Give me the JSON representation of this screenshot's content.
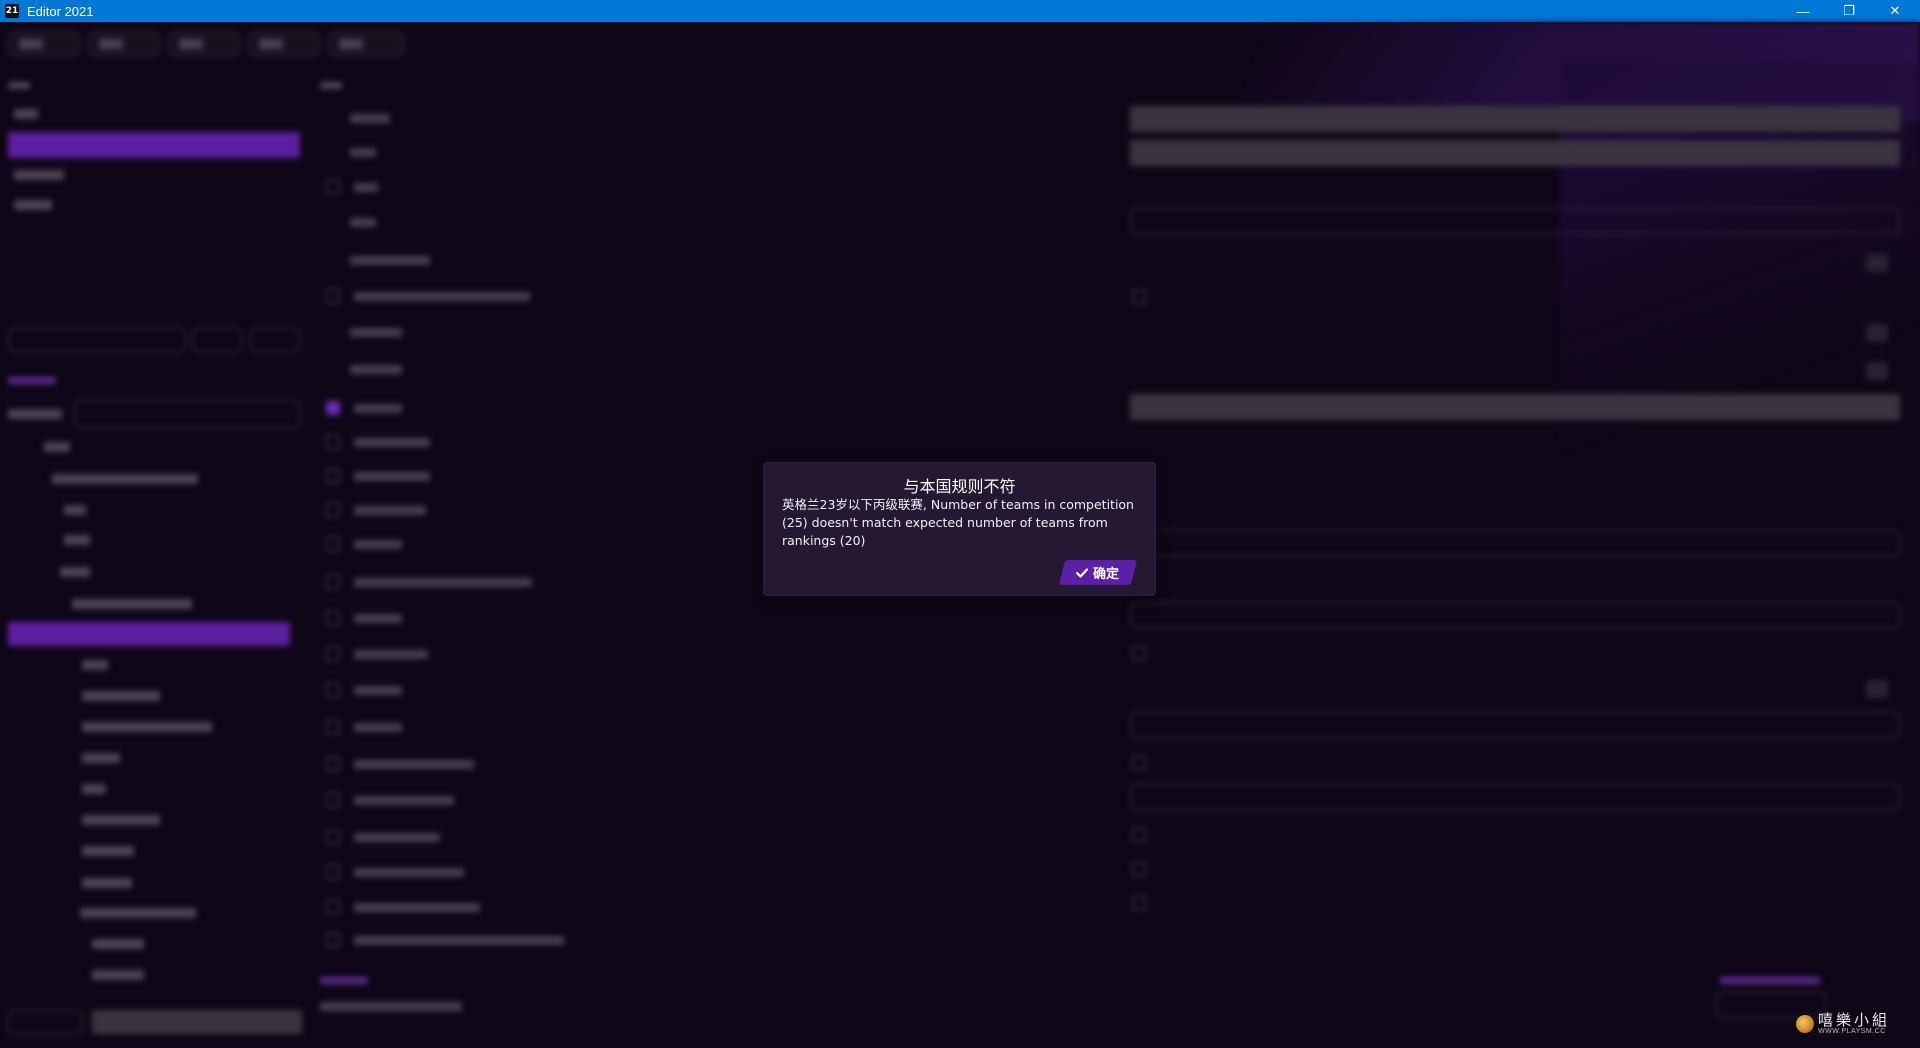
{
  "window": {
    "app_icon_text": "21",
    "title": "Editor 2021",
    "minimize_glyph": "—",
    "restore_glyph": "❐",
    "close_glyph": "✕"
  },
  "dialog": {
    "title": "与本国规则不符",
    "message": "英格兰23岁以下丙级联赛, Number of teams in competition (25) doesn't match expected number of teams from rankings (20)",
    "ok_icon": "check-icon",
    "ok_label": "确定"
  },
  "colors": {
    "titlebar": "#0078d7",
    "background": "#0f0717",
    "dialog_bg": "#241832",
    "accent_purple": "#5b1fa8"
  },
  "watermark": {
    "text": "嘻樂小組",
    "subtext": "WWW.PLAYSM.CC"
  }
}
